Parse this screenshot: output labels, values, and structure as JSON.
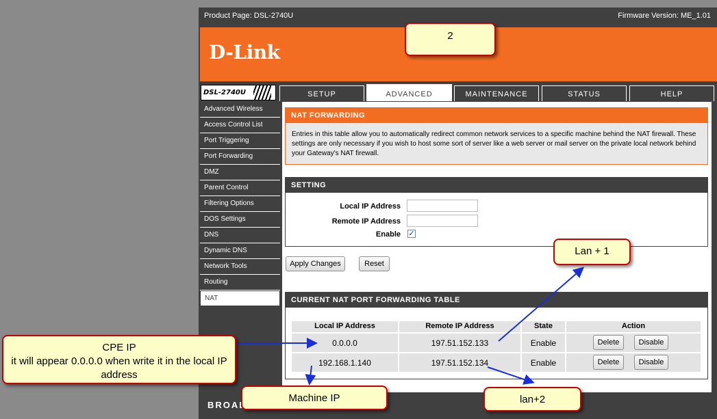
{
  "header": {
    "product": "Product Page: DSL-2740U",
    "firmware": "Firmware Version: ME_1.01"
  },
  "brand": {
    "logo": "D-Link",
    "model": "DSL-2740U"
  },
  "tabs": [
    {
      "label": "SETUP",
      "active": false
    },
    {
      "label": "ADVANCED",
      "active": true
    },
    {
      "label": "MAINTENANCE",
      "active": false
    },
    {
      "label": "STATUS",
      "active": false
    },
    {
      "label": "HELP",
      "active": false
    }
  ],
  "sidebar": {
    "items": [
      {
        "label": "Advanced Wireless"
      },
      {
        "label": "Access Control List"
      },
      {
        "label": "Port Triggering"
      },
      {
        "label": "Port Forwarding"
      },
      {
        "label": "DMZ"
      },
      {
        "label": "Parent Control"
      },
      {
        "label": "Filtering Options"
      },
      {
        "label": "DOS Settings"
      },
      {
        "label": "DNS"
      },
      {
        "label": "Dynamic DNS"
      },
      {
        "label": "Network Tools"
      },
      {
        "label": "Routing"
      },
      {
        "label": "NAT",
        "active": true
      }
    ]
  },
  "nat": {
    "title": "NAT FORWARDING",
    "description": "Entries in this table allow you to automatically redirect common network services to a specific machine behind the NAT firewall. These settings are only necessary if you wish to host some sort of server like a web server or mail server on the private local network behind your Gateway's NAT firewall."
  },
  "setting": {
    "title": "SETTING",
    "local_ip_label": "Local IP Address",
    "local_ip_value": "",
    "remote_ip_label": "Remote IP Address",
    "remote_ip_value": "",
    "enable_label": "Enable",
    "enable_checked": true,
    "apply_label": "Apply Changes",
    "reset_label": "Reset"
  },
  "table": {
    "title": "CURRENT NAT PORT FORWARDING TABLE",
    "columns": [
      "Local IP Address",
      "Remote IP Address",
      "State",
      "Action"
    ],
    "rows": [
      {
        "local": "0.0.0.0",
        "remote": "197.51.152.133",
        "state": "Enable",
        "delete": "Delete",
        "disable": "Disable"
      },
      {
        "local": "192.168.1.140",
        "remote": "197.51.152.134",
        "state": "Enable",
        "delete": "Delete",
        "disable": "Disable"
      }
    ]
  },
  "footer": {
    "text": "BROAD"
  },
  "callouts": {
    "c2": "2",
    "lan1": "Lan + 1",
    "cpe": "CPE IP\nit will appear 0.0.0.0 when write it in the local IP address",
    "machine": "Machine IP",
    "lan2": "lan+2"
  },
  "colors": {
    "accent": "#f26d21",
    "dark": "#404040",
    "callout_bg": "#fdfdc8",
    "callout_border": "#c80000",
    "arrow": "#1a2fd6"
  }
}
